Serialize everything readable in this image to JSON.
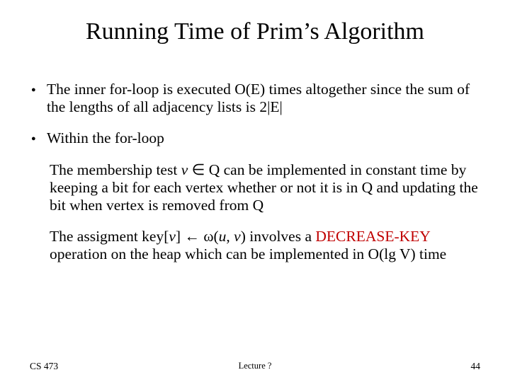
{
  "title": "Running Time of Prim’s Algorithm",
  "bullets": [
    {
      "text": "The inner for-loop is executed O(E) times altogether since the sum of the lengths of all adjacency lists is 2|E|"
    },
    {
      "text": "Within the for-loop",
      "sub1": {
        "pre": "The membership test ",
        "em": "v",
        "post": " ∈ Q can be implemented in  constant time by keeping a bit for each vertex whether or not it is in Q and updating the bit when vertex is removed from Q"
      },
      "sub2": {
        "p1": "The assigment key[",
        "p2": "v",
        "p3": "] ← ω(",
        "p4": "u",
        "p5": ", ",
        "p6": "v",
        "p7": ") involves a ",
        "red": "DECREASE-KEY",
        "p8": " operation on the heap which can be implemented in O(lg V) time"
      }
    }
  ],
  "footer": {
    "left": "CS 473",
    "center": "Lecture ?",
    "right": "44"
  }
}
